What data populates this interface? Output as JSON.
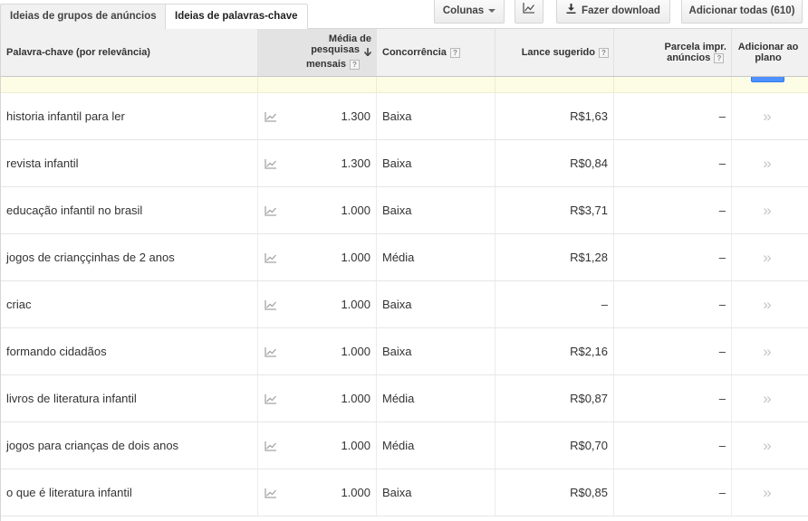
{
  "tabs": [
    {
      "label": "Ideias de grupos de anúncios",
      "active": false
    },
    {
      "label": "Ideias de palavras-chave",
      "active": true
    }
  ],
  "toolbar": {
    "columns_label": "Colunas",
    "chart_icon": "line-chart-icon",
    "download_label": "Fazer download",
    "download_icon": "download-icon",
    "add_all_label": "Adicionar todas (610)"
  },
  "table": {
    "headers": {
      "keyword": "Palavra-chave (por relevância)",
      "volume_line1": "Média de",
      "volume_line2": "pesquisas",
      "volume_line3": "mensais",
      "competition": "Concorrência",
      "bid": "Lance sugerido",
      "share_line1": "Parcela impr.",
      "share_line2": "anúncios",
      "add_line1": "Adicionar ao",
      "add_line2": "plano"
    },
    "help_glyph": "?",
    "sort_icon": "sort-down-arrow-icon",
    "rows": [
      {
        "keyword": "historia infantil para ler",
        "volume": "1.300",
        "competition": "Baixa",
        "bid": "R$1,63",
        "share": "–",
        "add": "»"
      },
      {
        "keyword": "revista infantil",
        "volume": "1.300",
        "competition": "Baixa",
        "bid": "R$0,84",
        "share": "–",
        "add": "»"
      },
      {
        "keyword": "educação infantil no brasil",
        "volume": "1.000",
        "competition": "Baixa",
        "bid": "R$3,71",
        "share": "–",
        "add": "»"
      },
      {
        "keyword": "jogos de crianççinhas de 2 anos",
        "volume": "1.000",
        "competition": "Média",
        "bid": "R$1,28",
        "share": "–",
        "add": "»"
      },
      {
        "keyword": "criac",
        "volume": "1.000",
        "competition": "Baixa",
        "bid": "–",
        "share": "–",
        "add": "»"
      },
      {
        "keyword": "formando cidadãos",
        "volume": "1.000",
        "competition": "Baixa",
        "bid": "R$2,16",
        "share": "–",
        "add": "»"
      },
      {
        "keyword": "livros de literatura infantil",
        "volume": "1.000",
        "competition": "Média",
        "bid": "R$0,87",
        "share": "–",
        "add": "»"
      },
      {
        "keyword": "jogos para crianças de dois anos",
        "volume": "1.000",
        "competition": "Média",
        "bid": "R$0,70",
        "share": "–",
        "add": "»"
      },
      {
        "keyword": "o que é literatura infantil",
        "volume": "1.000",
        "competition": "Baixa",
        "bid": "R$0,85",
        "share": "–",
        "add": "»"
      }
    ]
  },
  "colors": {
    "accent_blue": "#4d90fe",
    "header_bg": "#f1f1f1",
    "highlight_strip": "#fdfde6"
  }
}
